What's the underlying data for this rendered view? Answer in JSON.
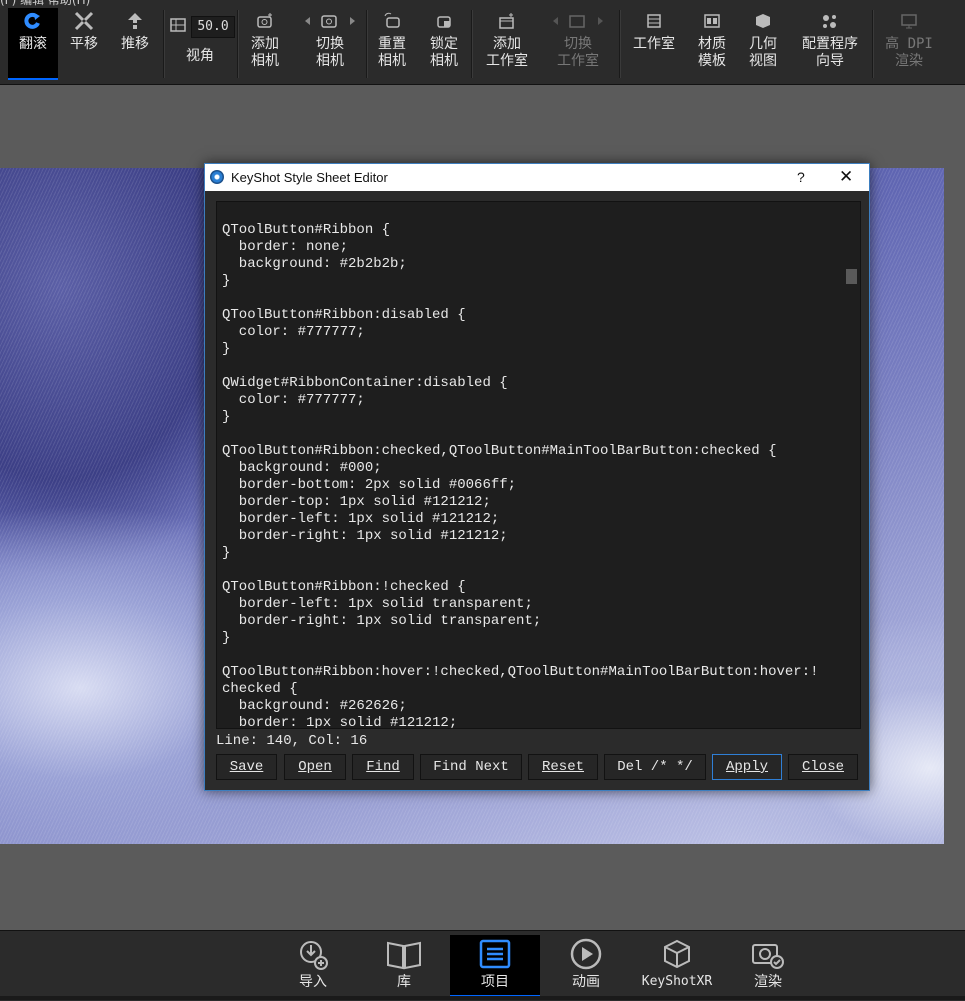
{
  "menu": {
    "partial_text": "(F) 编辑 帮助(H)"
  },
  "ribbon": {
    "buttons": [
      {
        "icon": "tumble-icon",
        "label": "翻滚"
      },
      {
        "icon": "pan-icon",
        "label": "平移"
      },
      {
        "icon": "dolly-icon",
        "label": "推移"
      },
      {
        "icon": "fov-icon",
        "label": "视角"
      },
      {
        "label": "添加\n相机",
        "icon": "add-camera-icon"
      },
      {
        "label": "切换\n相机",
        "icon": "switch-camera-icon"
      },
      {
        "label": "重置\n相机",
        "icon": "reset-camera-icon"
      },
      {
        "label": "锁定\n相机",
        "icon": "lock-camera-icon"
      },
      {
        "label": "添加\n工作室",
        "icon": "add-studio-icon"
      },
      {
        "label": "切换\n工作室",
        "icon": "switch-studio-icon"
      },
      {
        "label": "工作室",
        "icon": "studio-icon"
      },
      {
        "label": "材质\n模板",
        "icon": "material-template-icon"
      },
      {
        "label": "几何\n视图",
        "icon": "geometry-view-icon"
      },
      {
        "label": "配置程序\n向导",
        "icon": "configurator-wizard-icon"
      },
      {
        "label": "高 DPI\n渲染",
        "icon": "high-dpi-render-icon"
      }
    ],
    "fov_value": "50.0"
  },
  "dialog": {
    "title": "KeyShot Style Sheet Editor",
    "help": "?",
    "close": "✕",
    "code": "QToolButton#Ribbon {\n  border: none;\n  background: #2b2b2b;\n}\n\nQToolButton#Ribbon:disabled {\n  color: #777777;\n}\n\nQWidget#RibbonContainer:disabled {\n  color: #777777;\n}\n\nQToolButton#Ribbon:checked,QToolButton#MainToolBarButton:checked {\n  background: #000;\n  border-bottom: 2px solid #0066ff;\n  border-top: 1px solid #121212;\n  border-left: 1px solid #121212;\n  border-right: 1px solid #121212;\n}\n\nQToolButton#Ribbon:!checked {\n  border-left: 1px solid transparent;\n  border-right: 1px solid transparent;\n}\n\nQToolButton#Ribbon:hover:!checked,QToolButton#MainToolBarButton:hover:!\nchecked {\n  background: #262626;\n  border: 1px solid #121212;",
    "status": "Line: 140, Col: 16",
    "buttons": {
      "save": "Save",
      "open": "Open",
      "find": "Find",
      "find_next": "Find Next",
      "reset": "Reset",
      "del_comment": "Del /* */",
      "apply": "Apply",
      "close": "Close"
    }
  },
  "bottombar": {
    "items": [
      {
        "label": "导入",
        "icon": "import-icon"
      },
      {
        "label": "库",
        "icon": "library-icon"
      },
      {
        "label": "项目",
        "icon": "project-icon"
      },
      {
        "label": "动画",
        "icon": "animation-icon"
      },
      {
        "label": "KeyShotXR",
        "icon": "keyshotxr-icon"
      },
      {
        "label": "渲染",
        "icon": "render-icon"
      }
    ]
  },
  "colors": {
    "accent": "#0066ff",
    "ribbon_bg": "#2b2b2b",
    "editor_bg": "#1e1e1e",
    "disabled": "#777777"
  }
}
